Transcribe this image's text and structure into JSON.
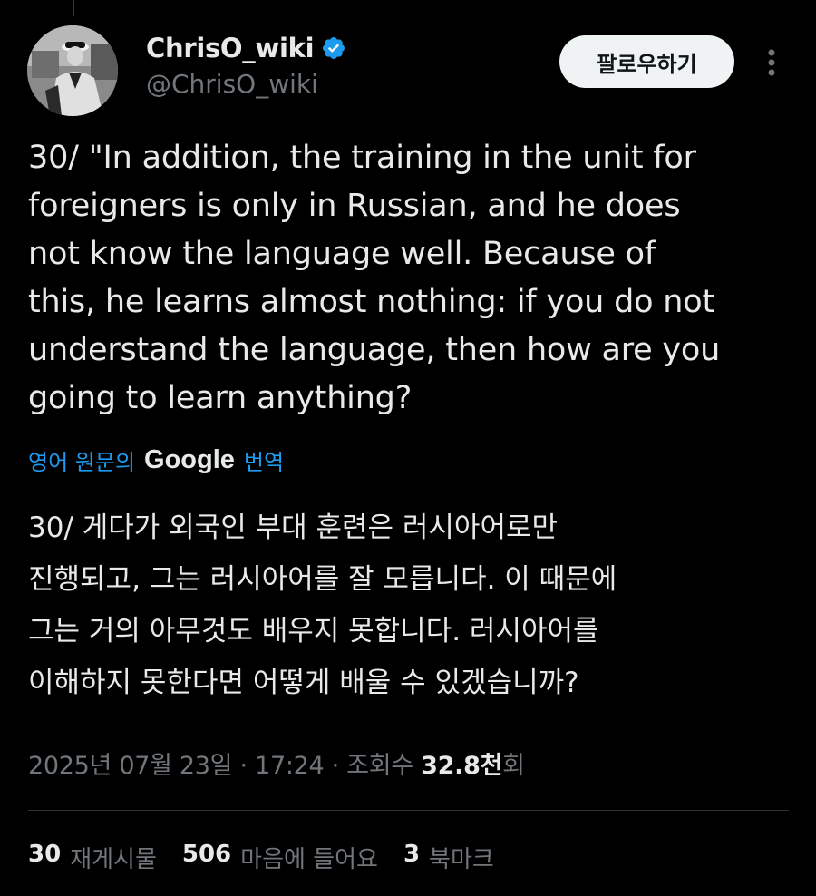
{
  "author": {
    "display_name": "ChrisO_wiki",
    "handle": "@ChrisO_wiki",
    "verified_icon": "verified-badge-icon",
    "verified_color": "#1d9bf0"
  },
  "actions": {
    "follow_label": "팔로우하기",
    "more_icon": "more-vertical-icon"
  },
  "tweet": {
    "text": "30/ \"In addition, the training in the unit for\nforeigners is only in Russian, and he does\nnot know the language well. Because of\nthis, he learns almost nothing: if you do not\nunderstand the language, then how are you\ngoing to learn anything?"
  },
  "translation": {
    "prefix": "영어 원문의",
    "provider": "Google",
    "suffix": "번역",
    "text": "30/ 게다가 외국인 부대 훈련은 러시아어로만\n진행되고, 그는 러시아어를 잘 모릅니다. 이 때문에\n그는 거의 아무것도 배우지 못합니다. 러시아어를\n이해하지 못한다면 어떻게 배울 수 있겠습니까?"
  },
  "meta": {
    "date": "2025년 07월 23일",
    "sep1": " · ",
    "time": "17:24",
    "sep2": " · ",
    "views_label": "조회수 ",
    "views_count": "32.8천",
    "views_suffix": "회"
  },
  "stats": [
    {
      "count": "30",
      "label": "재게시물"
    },
    {
      "count": "506",
      "label": "마음에 들어요"
    },
    {
      "count": "3",
      "label": "북마크"
    }
  ],
  "colors": {
    "background": "#000000",
    "text": "#e7e9ea",
    "muted": "#71767b",
    "accent": "#1d9bf0"
  }
}
